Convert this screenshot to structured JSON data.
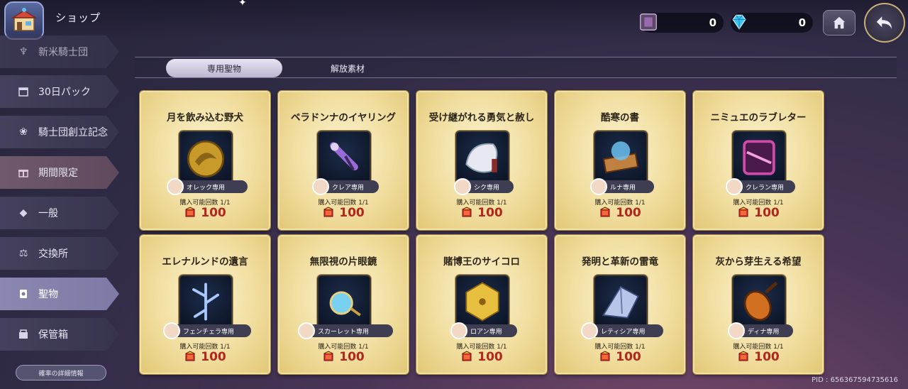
{
  "header": {
    "title": "ショップ",
    "currency1": {
      "icon": "crystal-box-icon",
      "value": "0"
    },
    "currency2": {
      "icon": "diamond-icon",
      "value": "0"
    }
  },
  "sidebar": {
    "items": [
      {
        "label": "新米騎士団",
        "icon": "sprout-icon"
      },
      {
        "label": "30日パック",
        "icon": "calendar-icon"
      },
      {
        "label": "騎士団創立記念",
        "icon": "flower-icon"
      },
      {
        "label": "期間限定",
        "icon": "gift-icon"
      },
      {
        "label": "一般",
        "icon": "gem-icon"
      },
      {
        "label": "交換所",
        "icon": "scale-icon"
      },
      {
        "label": "聖物",
        "icon": "relic-icon"
      },
      {
        "label": "保管箱",
        "icon": "storage-icon"
      }
    ],
    "active": "聖物",
    "prob_button": "確率の詳細情報"
  },
  "tabs": [
    {
      "label": "専用聖物",
      "active": true
    },
    {
      "label": "解放素材",
      "active": false
    }
  ],
  "cards": [
    {
      "name": "月を飲み込む野犬",
      "owner": "オレック専用",
      "limit": "購入可能回数 1/1",
      "price": "100",
      "icon": "moon-medallion-icon",
      "color": "#c89a2a"
    },
    {
      "name": "ベラドンナのイヤリング",
      "owner": "クレア専用",
      "limit": "購入可能回数 1/1",
      "price": "100",
      "icon": "earring-icon",
      "color": "#9a6ad8"
    },
    {
      "name": "受け継がれる勇気と赦し",
      "owner": "シク専用",
      "limit": "購入可能回数 1/1",
      "price": "100",
      "icon": "white-feather-icon",
      "color": "#e8e8f2"
    },
    {
      "name": "酷寒の書",
      "owner": "ルナ専用",
      "limit": "購入可能回数 1/1",
      "price": "100",
      "icon": "frost-book-icon",
      "color": "#6ac0f0"
    },
    {
      "name": "ニミュエのラブレター",
      "owner": "クレラン専用",
      "limit": "購入可能回数 1/1",
      "price": "100",
      "icon": "love-letter-scroll-icon",
      "color": "#d04aa8"
    },
    {
      "name": "エレナルンドの遺言",
      "owner": "フェンチェラ専用",
      "limit": "購入可能回数 1/1",
      "price": "100",
      "icon": "crystal-branch-icon",
      "color": "#a8c8ff"
    },
    {
      "name": "無限視の片眼鏡",
      "owner": "スカーレット専用",
      "limit": "購入可能回数 1/1",
      "price": "100",
      "icon": "monocle-icon",
      "color": "#7ad0f0"
    },
    {
      "name": "賭博王のサイコロ",
      "owner": "ロアン専用",
      "limit": "購入可能回数 1/1",
      "price": "100",
      "icon": "golden-dice-icon",
      "color": "#e8c040"
    },
    {
      "name": "発明と革新の雷竜",
      "owner": "レティシア専用",
      "limit": "購入可能回数 1/1",
      "price": "100",
      "icon": "thunder-dragon-icon",
      "color": "#b8c4e8"
    },
    {
      "name": "灰から芽生える希望",
      "owner": "ディナ専用",
      "limit": "購入可能回数 1/1",
      "price": "100",
      "icon": "ember-lute-icon",
      "color": "#d07020"
    }
  ],
  "footer": {
    "pid": "PID : 656367594735616"
  }
}
